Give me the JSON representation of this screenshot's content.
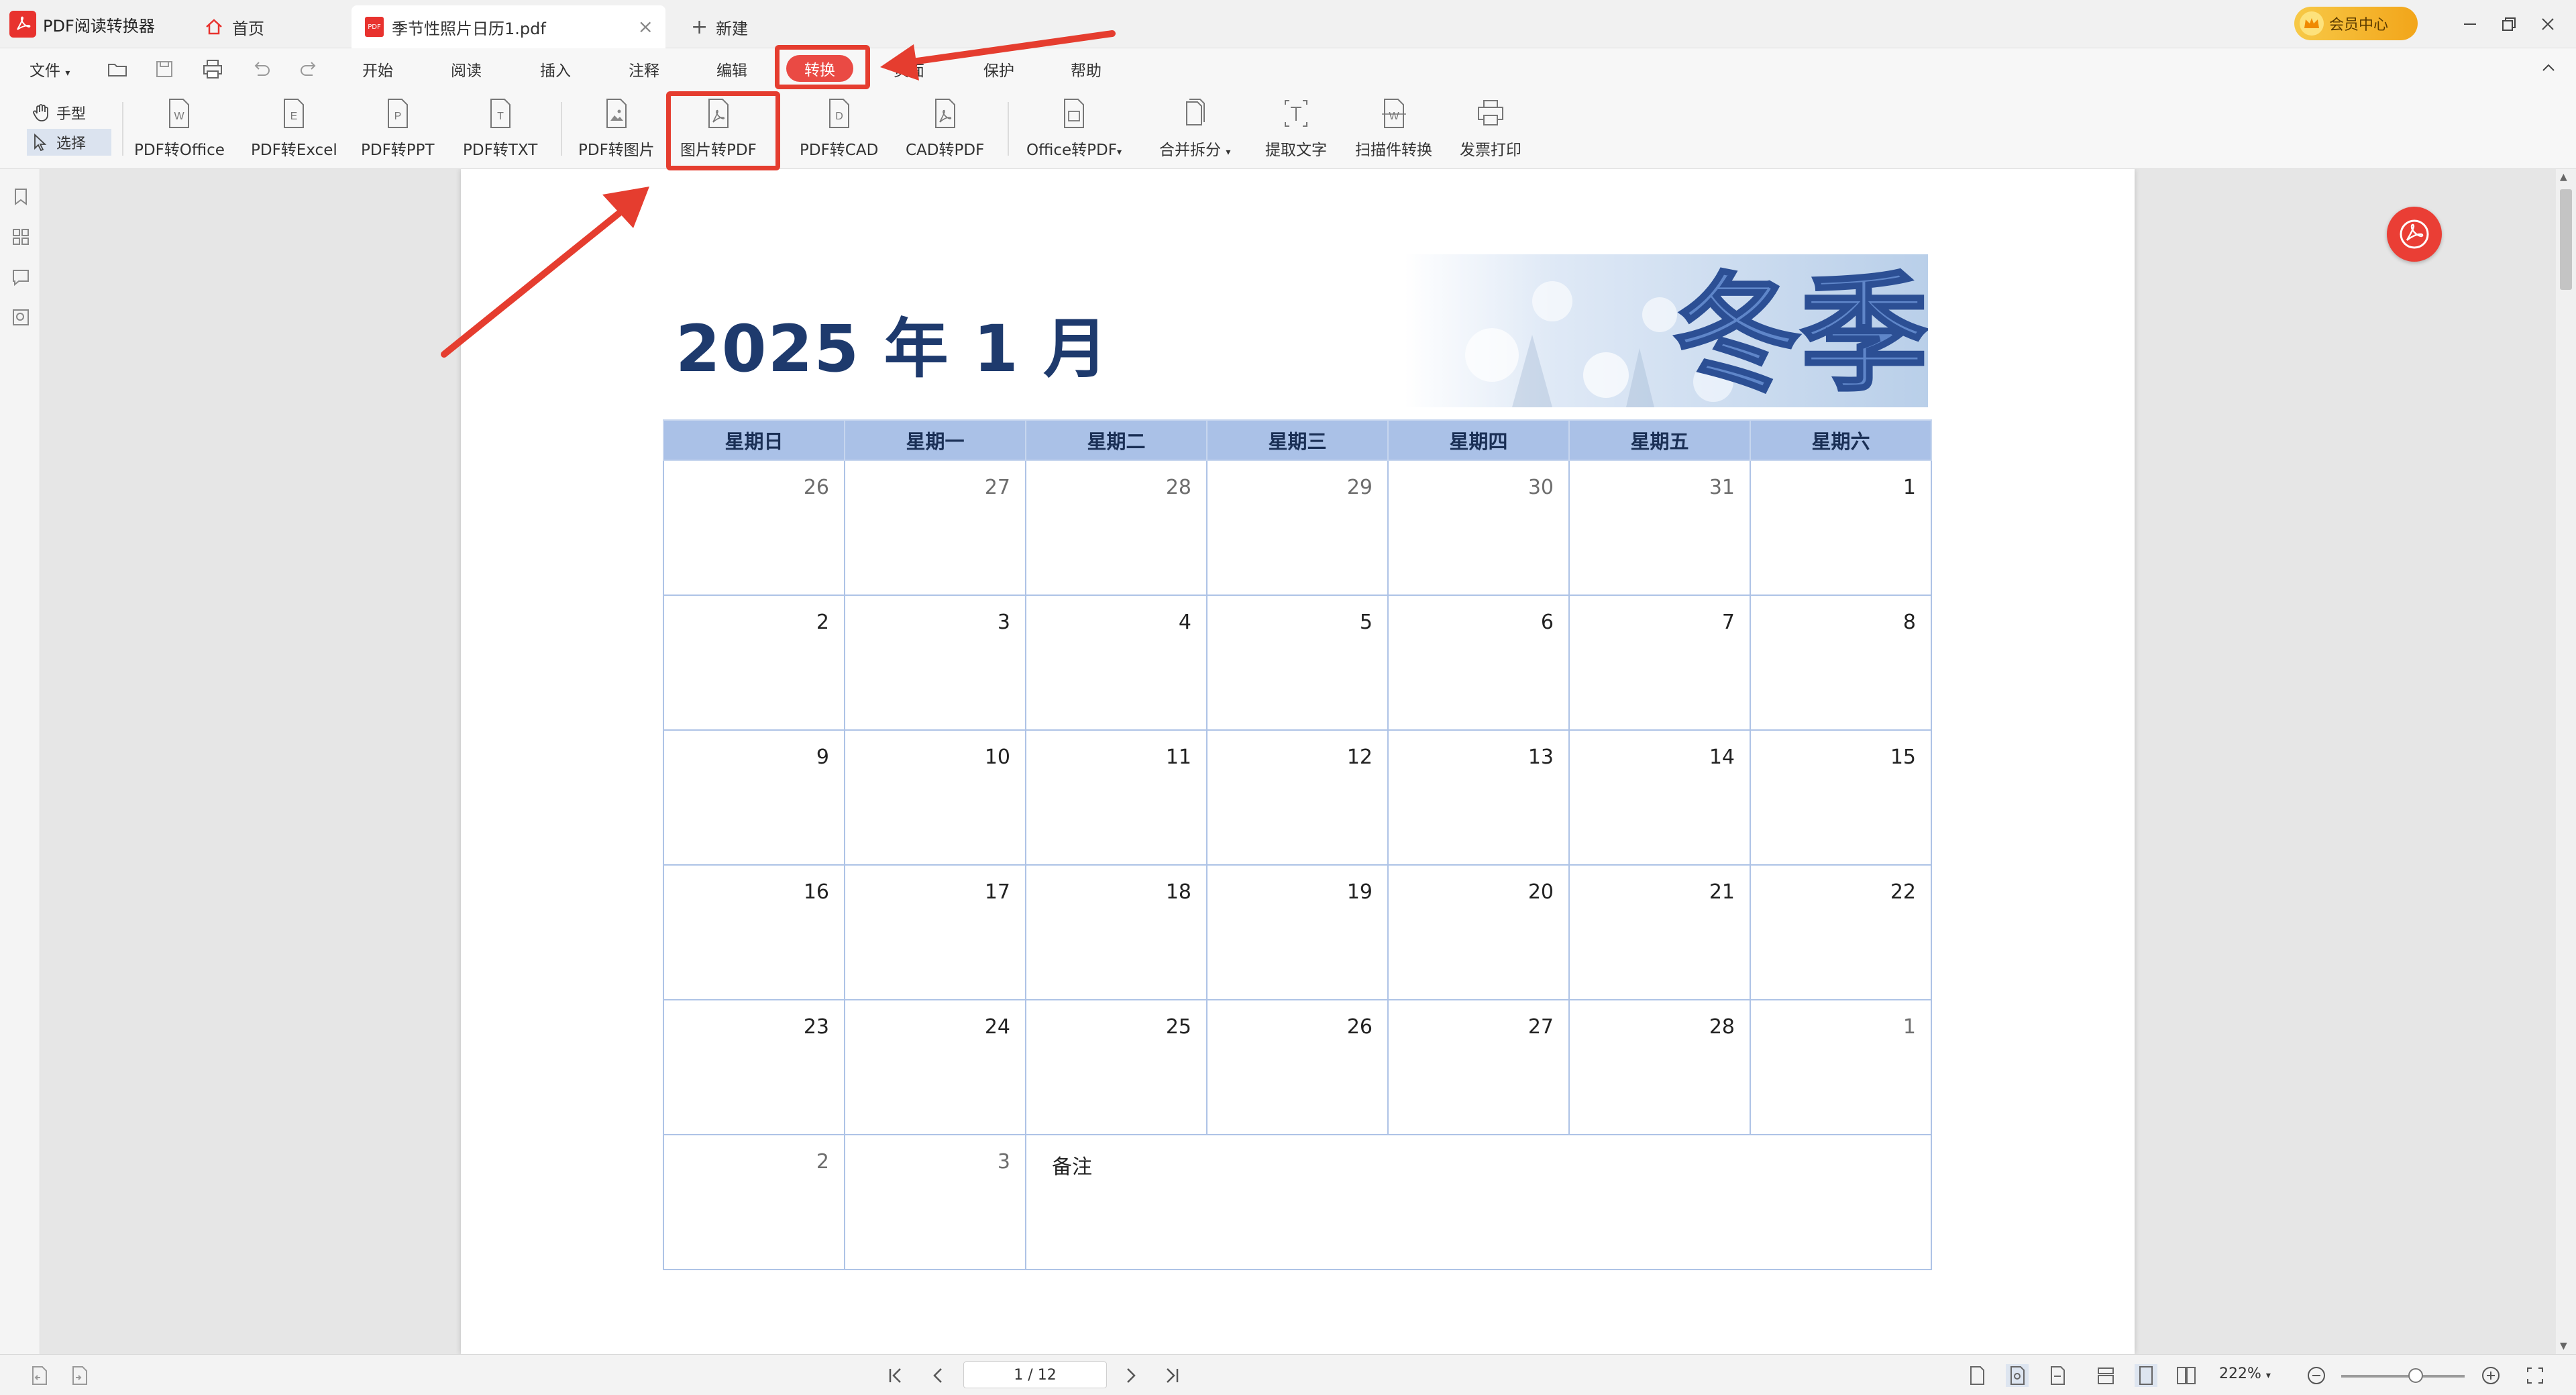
{
  "app": {
    "name": "PDF阅读转换器"
  },
  "tabs": {
    "home": "首页",
    "document": "季节性照片日历1.pdf",
    "new": "新建"
  },
  "vip": {
    "label": "会员中心"
  },
  "menu": {
    "file": "文件",
    "items": [
      "开始",
      "阅读",
      "插入",
      "注释",
      "编辑",
      "转换",
      "页面",
      "保护",
      "帮助"
    ],
    "active": "转换"
  },
  "ribbon": {
    "modes": {
      "hand": "手型",
      "select": "选择"
    },
    "buttons": [
      "PDF转Office",
      "PDF转Excel",
      "PDF转PPT",
      "PDF转TXT",
      "PDF转图片",
      "图片转PDF",
      "PDF转CAD",
      "CAD转PDF",
      "Office转PDF",
      "合并拆分",
      "提取文字",
      "扫描件转换",
      "发票打印"
    ]
  },
  "calendar": {
    "title": "2025 年 1 月",
    "banner_text": "冬季",
    "weekdays": [
      "星期日",
      "星期一",
      "星期二",
      "星期三",
      "星期四",
      "星期五",
      "星期六"
    ],
    "weeks": [
      [
        "26",
        "27",
        "28",
        "29",
        "30",
        "31",
        "1"
      ],
      [
        "2",
        "3",
        "4",
        "5",
        "6",
        "7",
        "8"
      ],
      [
        "9",
        "10",
        "11",
        "12",
        "13",
        "14",
        "15"
      ],
      [
        "16",
        "17",
        "18",
        "19",
        "20",
        "21",
        "22"
      ],
      [
        "23",
        "24",
        "25",
        "26",
        "27",
        "28",
        "1"
      ],
      [
        "2",
        "3"
      ]
    ],
    "notes_label": "备注"
  },
  "status": {
    "page": "1 / 12",
    "zoom": "222%"
  },
  "colors": {
    "accent": "#e53d2f",
    "header_fill": "#aac1e7",
    "title": "#1e3a6d",
    "vip_gold": "#f2a51a"
  }
}
